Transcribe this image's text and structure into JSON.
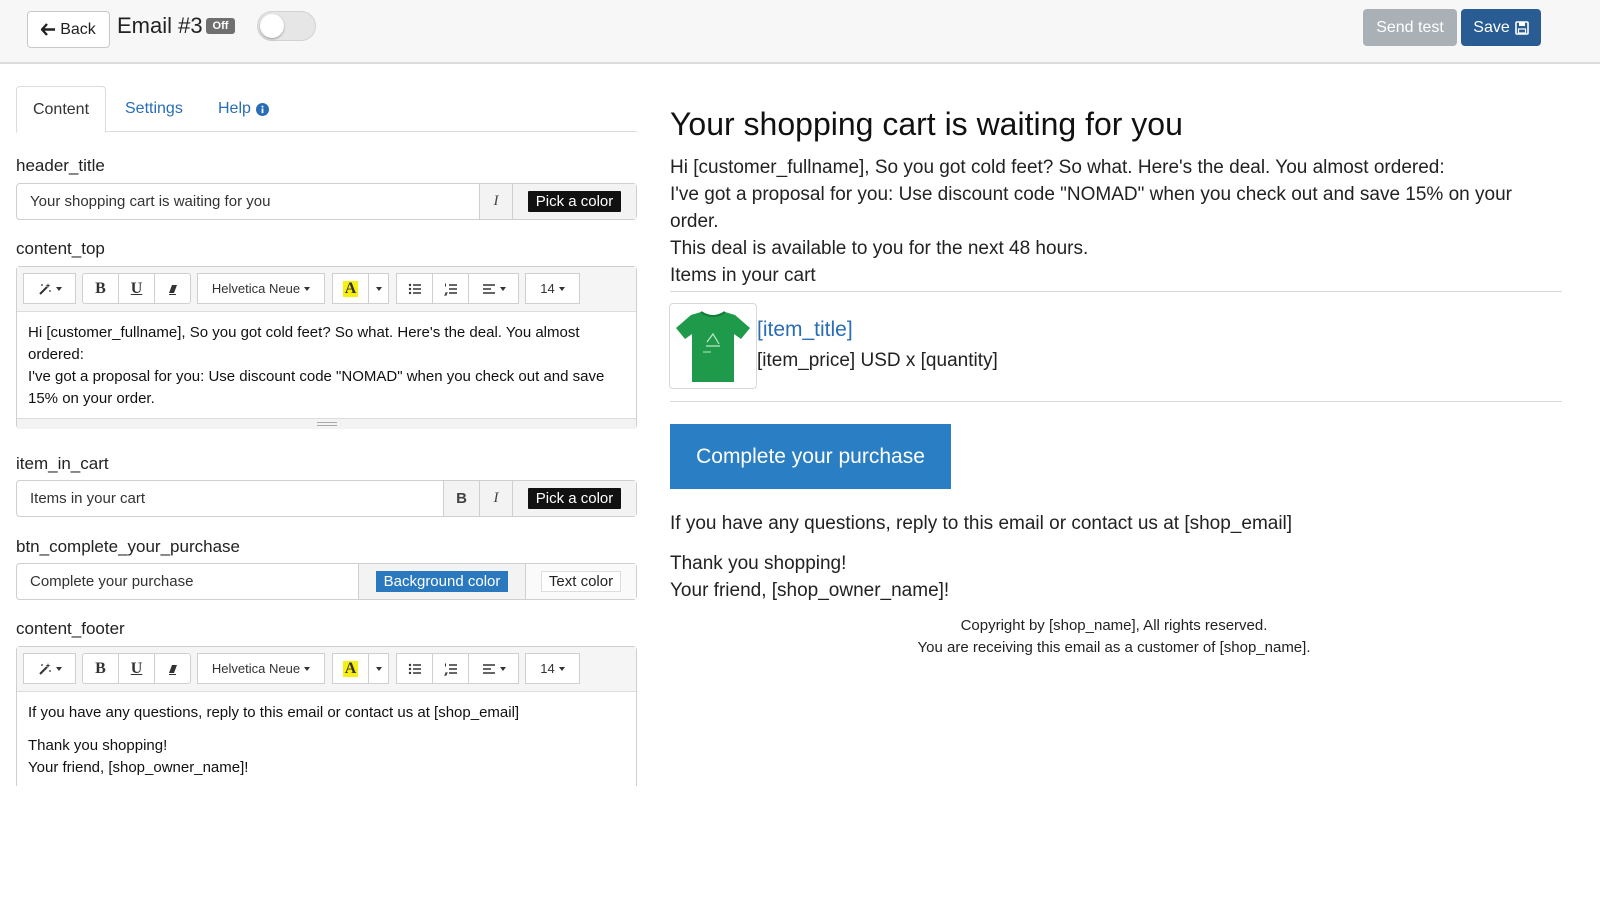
{
  "topbar": {
    "back_label": "Back",
    "title": "Email #3",
    "status_badge": "Off",
    "toggle_on": false,
    "send_test_label": "Send test",
    "save_label": "Save"
  },
  "tabs": [
    {
      "label": "Content",
      "active": true
    },
    {
      "label": "Settings",
      "active": false
    },
    {
      "label": "Help",
      "active": false
    }
  ],
  "fields": {
    "header_title": {
      "label": "header_title",
      "value": "Your shopping cart is waiting for you",
      "italic_label": "I",
      "color_label": "Pick a color"
    },
    "content_top": {
      "label": "content_top",
      "font_name": "Helvetica Neue",
      "font_size": "14",
      "bold_label": "B",
      "underline_label": "U",
      "highlight_label": "A",
      "lines": [
        "Hi [customer_fullname], So you got cold feet? So what. Here's the deal. You almost ordered:",
        "I've got a proposal for you: Use discount code \"NOMAD\" when you check out and save 15% on your order."
      ]
    },
    "item_in_cart": {
      "label": "item_in_cart",
      "value": "Items in your cart",
      "bold_label": "B",
      "italic_label": "I",
      "color_label": "Pick a color"
    },
    "btn_complete_your_purchase": {
      "label": "btn_complete_your_purchase",
      "value": "Complete your purchase",
      "bg_color_label": "Background color",
      "text_color_label": "Text color"
    },
    "content_footer": {
      "label": "content_footer",
      "font_name": "Helvetica Neue",
      "font_size": "14",
      "bold_label": "B",
      "underline_label": "U",
      "highlight_label": "A",
      "line1": "If you have any questions, reply to this email or contact us at [shop_email]",
      "line2": "Thank you shopping!",
      "line3": "Your friend, [shop_owner_name]!"
    }
  },
  "preview": {
    "title": "Your shopping cart is waiting for you",
    "lines": [
      "Hi [customer_fullname], So you got cold feet? So what. Here's the deal. You almost ordered:",
      "I've got a proposal for you: Use discount code \"NOMAD\" when you check out and save 15% on your order.",
      "This deal is available to you for the next 48 hours.",
      "Items in your cart"
    ],
    "item_title": "[item_title]",
    "item_price": "[item_price] USD x [quantity]",
    "cta_label": "Complete your purchase",
    "questions": "If you have any questions, reply to this email or contact us at [shop_email]",
    "thanks": "Thank you shopping!",
    "signoff": "Your friend, [shop_owner_name]!",
    "copyright": "Copyright by [shop_name], All rights reserved.",
    "receiving": "You are receiving this email as a customer of [shop_name]."
  },
  "colors": {
    "primary": "#285c92",
    "link": "#2a6db7",
    "cta": "#2a7ec3",
    "muted_button": "#a9b0b6",
    "shirt": "#1f9a4a"
  }
}
